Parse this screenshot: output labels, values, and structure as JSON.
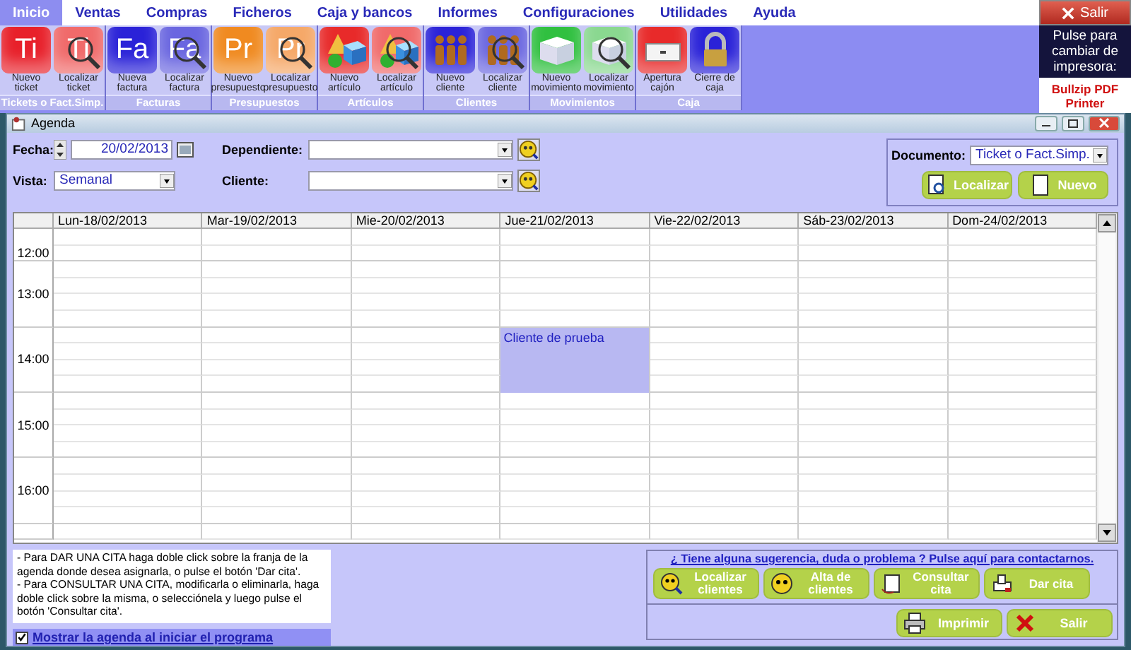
{
  "menu": [
    {
      "label": "Inicio",
      "selected": true
    },
    {
      "label": "Ventas",
      "selected": false
    },
    {
      "label": "Compras",
      "selected": false
    },
    {
      "label": "Ficheros",
      "selected": false
    },
    {
      "label": "Caja y bancos",
      "selected": false
    },
    {
      "label": "Informes",
      "selected": false
    },
    {
      "label": "Configuraciones",
      "selected": false
    },
    {
      "label": "Utilidades",
      "selected": false
    },
    {
      "label": "Ayuda",
      "selected": false
    }
  ],
  "ribbon": [
    {
      "label": "Tickets o Fact.Simp.",
      "buttons": [
        {
          "label": "Nuevo ticket",
          "kind": "letters",
          "letters": "Ti",
          "color": "#e8202a",
          "search": false
        },
        {
          "label": "Localizar ticket",
          "kind": "letters",
          "letters": "Ti",
          "color": "#f06a6a",
          "search": true
        }
      ]
    },
    {
      "label": "Facturas",
      "buttons": [
        {
          "label": "Nueva factura",
          "kind": "letters",
          "letters": "Fa",
          "color": "#2a22d8",
          "search": false
        },
        {
          "label": "Localizar factura",
          "kind": "letters",
          "letters": "Fa",
          "color": "#6a66e0",
          "search": true
        }
      ]
    },
    {
      "label": "Presupuestos",
      "buttons": [
        {
          "label": "Nuevo presupuesto",
          "kind": "letters",
          "letters": "Pr",
          "color": "#f08a20",
          "search": false
        },
        {
          "label": "Localizar presupuesto",
          "kind": "letters",
          "letters": "Pr",
          "color": "#f5a868",
          "search": true
        }
      ]
    },
    {
      "label": "Artículos",
      "buttons": [
        {
          "label": "Nuevo artículo",
          "kind": "shapes",
          "color": "#e82a2a",
          "search": false
        },
        {
          "label": "Localizar artículo",
          "kind": "shapes",
          "color": "#f06a6a",
          "search": true
        }
      ]
    },
    {
      "label": "Clientes",
      "buttons": [
        {
          "label": "Nuevo cliente",
          "kind": "people",
          "color": "#2a22d8",
          "search": false
        },
        {
          "label": "Localizar cliente",
          "kind": "people",
          "color": "#6a66e0",
          "search": true
        }
      ]
    },
    {
      "label": "Movimientos",
      "buttons": [
        {
          "label": "Nuevo movimiento",
          "kind": "book",
          "color": "#30c040",
          "search": false
        },
        {
          "label": "Localizar movimiento",
          "kind": "book",
          "color": "#8ad890",
          "search": true
        }
      ]
    },
    {
      "label": "Caja",
      "buttons": [
        {
          "label": "Apertura cajón",
          "kind": "drawer",
          "color": "#e82a2a",
          "search": false
        },
        {
          "label": "Cierre de caja",
          "kind": "lock",
          "color": "#2a22d8",
          "search": false
        }
      ]
    }
  ],
  "exit_button": "Salir",
  "printer": {
    "prompt": "Pulse para cambiar de impresora:",
    "name": "Bullzip PDF Printer"
  },
  "agenda": {
    "title": "Agenda",
    "fecha": {
      "label": "Fecha:",
      "value": "20/02/2013"
    },
    "vista": {
      "label": "Vista:",
      "value": "Semanal"
    },
    "dependiente": {
      "label": "Dependiente:"
    },
    "cliente": {
      "label": "Cliente:"
    },
    "documento": {
      "label": "Documento:",
      "value": "Ticket o Fact.Simp.",
      "buttons": [
        "Localizar",
        "Nuevo"
      ]
    },
    "hours": [
      {
        "label": "12:00",
        "cells": [
          {
            "booked": false
          },
          {
            "booked": false
          },
          {
            "booked": false
          },
          {
            "booked": false
          },
          {
            "booked": false
          },
          {
            "booked": false
          },
          {
            "booked": false
          }
        ]
      },
      {
        "label": "13:00",
        "cells": [
          {
            "booked": false
          },
          {
            "booked": false
          },
          {
            "booked": false
          },
          {
            "booked": false
          },
          {
            "booked": false
          },
          {
            "booked": false
          },
          {
            "booked": false
          }
        ]
      },
      {
        "label": "14:00",
        "cells": [
          {
            "booked": false
          },
          {
            "booked": false
          },
          {
            "booked": false
          },
          {
            "booked": true,
            "text": "Cliente de prueba"
          },
          {
            "booked": false
          },
          {
            "booked": false
          },
          {
            "booked": false
          }
        ]
      },
      {
        "label": "15:00",
        "cells": [
          {
            "booked": false
          },
          {
            "booked": false
          },
          {
            "booked": false
          },
          {
            "booked": false
          },
          {
            "booked": false
          },
          {
            "booked": false
          },
          {
            "booked": false
          }
        ]
      },
      {
        "label": "16:00",
        "cells": [
          {
            "booked": false
          },
          {
            "booked": false
          },
          {
            "booked": false
          },
          {
            "booked": false
          },
          {
            "booked": false
          },
          {
            "booked": false
          },
          {
            "booked": false
          }
        ]
      }
    ],
    "days": [
      {
        "header": "Lun-18/02/2013"
      },
      {
        "header": "Mar-19/02/2013"
      },
      {
        "header": "Mie-20/02/2013"
      },
      {
        "header": "Jue-21/02/2013"
      },
      {
        "header": "Vie-22/02/2013"
      },
      {
        "header": "Sáb-23/02/2013"
      },
      {
        "header": "Dom-24/02/2013"
      }
    ],
    "help": [
      "- Para DAR UNA CITA haga doble click sobre la franja de la agenda donde desea asignarla, o pulse el botón 'Dar cita'.",
      "- Para CONSULTAR UNA CITA, modificarla o eliminarla, haga doble click sobre la misma, o selecciónela y luego pulse el botón 'Consultar cita'."
    ],
    "show_on_start": {
      "label": "Mostrar la agenda al iniciar el programa",
      "checked": true
    },
    "contact_link": "¿ Tiene alguna sugerencia, duda o problema ? Pulse aquí para contactarnos.",
    "actions": [
      {
        "label": "Localizar clientes",
        "kind": "find-client"
      },
      {
        "label": "Alta de clientes",
        "kind": "new-client"
      },
      {
        "label": "Consultar cita",
        "kind": "view"
      },
      {
        "label": "Dar cita",
        "kind": "give"
      }
    ],
    "footer_buttons": [
      {
        "label": "Imprimir",
        "kind": "print"
      },
      {
        "label": "Salir",
        "kind": "exit"
      }
    ]
  }
}
